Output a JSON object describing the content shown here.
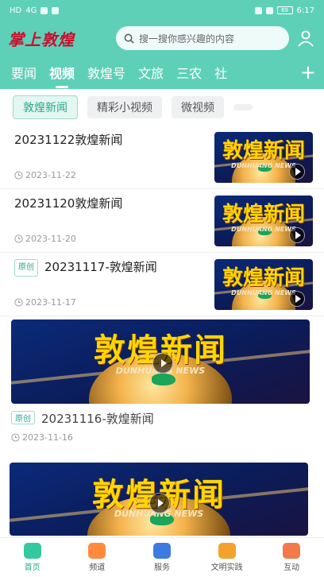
{
  "status": {
    "time": "6:17",
    "battery": "69",
    "left_icons": "HD",
    "signal": "4G"
  },
  "header": {
    "logo": "掌上敦煌",
    "search_placeholder": "搜一搜你感兴趣的内容"
  },
  "nav_tabs": [
    "要闻",
    "视频",
    "敦煌号",
    "文旅",
    "三农",
    "社"
  ],
  "nav_active": 1,
  "chips": [
    "敦煌新闻",
    "精彩小视频",
    "微视频"
  ],
  "chip_active": 0,
  "thumb_title": "敦煌新闻",
  "thumb_sub": "DUNHUANG NEWS",
  "feed": [
    {
      "title": "20231122敦煌新闻",
      "date": "2023-11-22",
      "tag": ""
    },
    {
      "title": "20231120敦煌新闻",
      "date": "2023-11-20",
      "tag": ""
    },
    {
      "title": "20231117-敦煌新闻",
      "date": "2023-11-17",
      "tag": "原创"
    },
    {
      "title": "20231116-敦煌新闻",
      "date": "2023-11-16",
      "tag": "原创"
    }
  ],
  "tabbar": [
    {
      "label": "首页",
      "icon": "home-icon",
      "color": "#34c8a0"
    },
    {
      "label": "频道",
      "icon": "channel-icon",
      "color": "#ff8a3d"
    },
    {
      "label": "服务",
      "icon": "service-icon",
      "color": "#3d7be0"
    },
    {
      "label": "文明实践",
      "icon": "practice-icon",
      "color": "#f4a22d"
    },
    {
      "label": "互动",
      "icon": "interact-icon",
      "color": "#f27a4a"
    }
  ],
  "tab_active": 0,
  "colors": {
    "brand": "#5fd0b8",
    "accent": "#2aa889",
    "logo": "#c8102e"
  }
}
